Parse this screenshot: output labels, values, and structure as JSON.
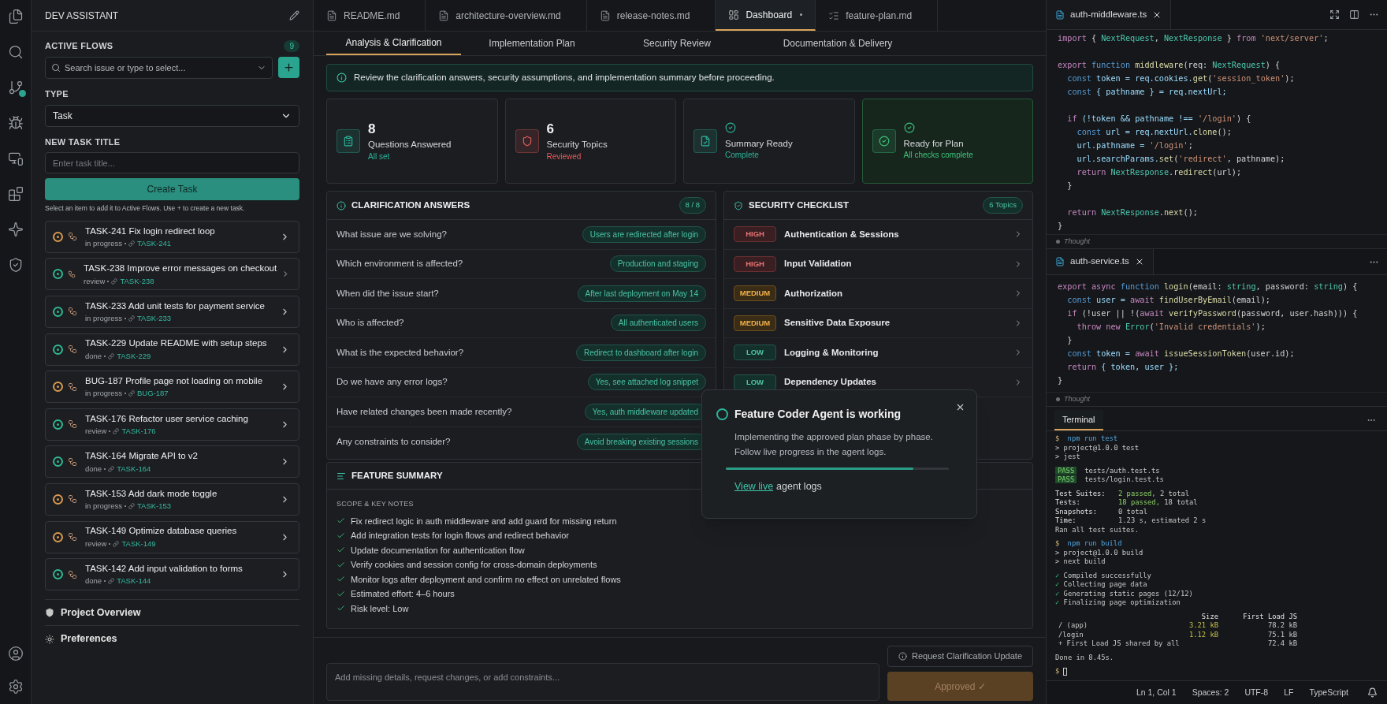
{
  "activity_bar": {
    "top": [
      {
        "kind": "files"
      },
      {
        "kind": "search"
      },
      {
        "kind": "git"
      },
      {
        "kind": "debug"
      },
      {
        "kind": "remote"
      },
      {
        "kind": "extensions"
      },
      {
        "kind": "sparkle"
      },
      {
        "kind": "shield"
      }
    ],
    "bottom": [
      {
        "kind": "account"
      },
      {
        "kind": "settings"
      }
    ]
  },
  "sidebar": {
    "title": "DEV ASSISTANT",
    "active_flows_label": "ACTIVE FLOWS",
    "active_flows_count": "9",
    "search": {
      "placeholder": "Search issue or type to select..."
    },
    "type_label": "TYPE",
    "type_value": "Task",
    "title_label": "NEW TASK TITLE",
    "title_field": {
      "placeholder": "Enter task title..."
    },
    "create_button": "Create Task",
    "help": "Select an item to add it to Active Flows. Use + to create a new task.",
    "tasks": [
      {
        "title": "TASK-241 Fix login redirect loop",
        "status": "in progress",
        "link": "TASK-241",
        "color": "#d99a4e"
      },
      {
        "title": "TASK-238 Improve error messages on checkout",
        "status": "review",
        "link": "TASK-238",
        "color": "#2fb88f"
      },
      {
        "title": "TASK-233 Add unit tests for payment service",
        "status": "in progress",
        "link": "TASK-233",
        "color": "#2fb88f"
      },
      {
        "title": "TASK-229 Update README with setup steps",
        "status": "done",
        "link": "TASK-229",
        "color": "#2fb88f"
      },
      {
        "title": "BUG-187 Profile page not loading on mobile",
        "status": "in progress",
        "link": "BUG-187",
        "color": "#d99a4e"
      },
      {
        "title": "TASK-176 Refactor user service caching",
        "status": "review",
        "link": "TASK-176",
        "color": "#2fb88f"
      },
      {
        "title": "TASK-164 Migrate API to v2",
        "status": "done",
        "link": "TASK-164",
        "color": "#2fb88f"
      },
      {
        "title": "TASK-153 Add dark mode toggle",
        "status": "in progress",
        "link": "TASK-153",
        "color": "#d99a4e"
      },
      {
        "title": "TASK-149 Optimize database queries",
        "status": "review",
        "link": "TASK-149",
        "color": "#d99a4e"
      },
      {
        "title": "TASK-142 Add input validation to forms",
        "status": "done",
        "link": "TASK-144",
        "color": "#2fb88f"
      }
    ],
    "footer_links": [
      {
        "label": "Project Overview",
        "kind": "shield"
      },
      {
        "label": "Preferences",
        "kind": "sun"
      }
    ]
  },
  "editor_tabs": [
    {
      "label": "README.md",
      "kind": "doc",
      "selected": false,
      "modified": false
    },
    {
      "label": "architecture-overview.md",
      "kind": "doc",
      "selected": false,
      "modified": false
    },
    {
      "label": "release-notes.md",
      "kind": "doc",
      "selected": false,
      "modified": false
    },
    {
      "label": "Dashboard",
      "kind": "dashboard",
      "selected": true,
      "modified": true
    },
    {
      "label": "feature-plan.md",
      "kind": "plan",
      "selected": false,
      "modified": false
    }
  ],
  "sub_tabs": [
    {
      "label": "Analysis & Clarification",
      "selected": true
    },
    {
      "label": "Implementation Plan",
      "selected": false
    },
    {
      "label": "Security Review",
      "selected": false
    },
    {
      "label": "Documentation & Delivery",
      "selected": false
    }
  ],
  "banner": "Review the clarification answers, security assumptions, and implementation summary before proceeding.",
  "stats": [
    {
      "kind": "count",
      "value": "8",
      "label": "Questions Answered",
      "sub": "All set",
      "color": "#2bb59a",
      "highlighted": false
    },
    {
      "kind": "count",
      "value": "6",
      "label": "Security Topics",
      "sub": "Reviewed",
      "color": "#e05a5a",
      "highlighted": false
    },
    {
      "kind": "check",
      "label": "Summary Ready",
      "sub": "Complete",
      "color": "#2bb59a",
      "highlighted": false
    },
    {
      "kind": "check",
      "label": "Ready for Plan",
      "sub": "All checks complete",
      "color": "#3cc47a",
      "highlighted": true
    }
  ],
  "clarification": {
    "title": "CLARIFICATION ANSWERS",
    "count": "8 / 8",
    "rows": [
      {
        "question": "What issue are we solving?",
        "answer": "Users are redirected after login"
      },
      {
        "question": "Which environment is affected?",
        "answer": "Production and staging"
      },
      {
        "question": "When did the issue start?",
        "answer": "After last deployment on May 14"
      },
      {
        "question": "Who is affected?",
        "answer": "All authenticated users"
      },
      {
        "question": "What is the expected behavior?",
        "answer": "Redirect to dashboard after login"
      },
      {
        "question": "Do we have any error logs?",
        "answer": "Yes, see attached log snippet"
      },
      {
        "question": "Have related changes been made recently?",
        "answer": "Yes, auth middleware updated"
      },
      {
        "question": "Any constraints to consider?",
        "answer": "Avoid breaking existing sessions"
      }
    ]
  },
  "security": {
    "title": "SECURITY CHECKLIST",
    "count": "6 Topics",
    "rows": [
      {
        "severity": "HIGH",
        "kind": "high",
        "topic": "Authentication & Sessions"
      },
      {
        "severity": "HIGH",
        "kind": "high",
        "topic": "Input Validation"
      },
      {
        "severity": "MEDIUM",
        "kind": "medium",
        "topic": "Authorization"
      },
      {
        "severity": "MEDIUM",
        "kind": "medium",
        "topic": "Sensitive Data Exposure"
      },
      {
        "severity": "LOW",
        "kind": "low",
        "topic": "Logging & Monitoring"
      },
      {
        "severity": "LOW",
        "kind": "low",
        "topic": "Dependency Updates"
      }
    ]
  },
  "summary": {
    "title": "FEATURE SUMMARY",
    "subtitle": "SCOPE & KEY NOTES",
    "items": [
      "Fix redirect logic in auth middleware and add guard for missing return",
      "Add integration tests for login flows and redirect behavior",
      "Update documentation for authentication flow",
      "Verify cookies and session config for cross-domain deployments",
      "Monitor logs after deployment and confirm no effect on unrelated flows",
      "Estimated effort: 4–6 hours",
      "Risk level: Low"
    ]
  },
  "composer": {
    "placeholder": "Add missing details, request changes, or add constraints...",
    "request_button": "Request Clarification Update",
    "approve_button": {
      "label": "Approved ✓",
      "disabled": true
    }
  },
  "agent_popup": {
    "title": "Feature Coder Agent is working",
    "lines": [
      "Implementing the approved plan phase by phase.",
      "Follow live progress in the agent logs."
    ],
    "level": 0.84,
    "link": "View live",
    "link_suffix": "agent logs"
  },
  "editors": [
    {
      "tab": "auth-middleware.ts",
      "footer": "Thought",
      "lines": [
        {
          "blank_before": false,
          "segs": [
            {
              "t": "import",
              "kind": "keyword"
            },
            {
              "t": " {",
              "kind": "plain"
            },
            {
              "t": " NextRequest",
              "kind": "type"
            },
            {
              "t": ",",
              "kind": "plain"
            },
            {
              "t": " NextResponse",
              "kind": "type"
            },
            {
              "t": " }",
              "kind": "plain"
            },
            {
              "t": " from",
              "kind": "keyword"
            },
            {
              "t": " 'next/server'",
              "kind": "string"
            },
            {
              "t": ";",
              "kind": "plain"
            }
          ]
        },
        {
          "blank_before": true,
          "segs": [
            {
              "t": "export",
              "kind": "keyword"
            },
            {
              "t": " function",
              "kind": "decl"
            },
            {
              "t": " middleware",
              "kind": "func"
            },
            {
              "t": "(req: ",
              "kind": "plain"
            },
            {
              "t": "NextRequest",
              "kind": "type"
            },
            {
              "t": ") {",
              "kind": "plain"
            }
          ]
        },
        {
          "blank_before": false,
          "segs": [
            {
              "t": "  const",
              "kind": "decl"
            },
            {
              "t": " token = req.cookies.",
              "kind": "var"
            },
            {
              "t": "get",
              "kind": "func"
            },
            {
              "t": "(",
              "kind": "plain"
            },
            {
              "t": "'session_token'",
              "kind": "string"
            },
            {
              "t": ");",
              "kind": "plain"
            }
          ]
        },
        {
          "blank_before": false,
          "segs": [
            {
              "t": "  const",
              "kind": "decl"
            },
            {
              "t": " { pathname } = req.nextUrl;",
              "kind": "var"
            }
          ]
        },
        {
          "blank_before": true,
          "segs": [
            {
              "t": "  if",
              "kind": "keyword"
            },
            {
              "t": " (!token && pathname !== ",
              "kind": "var"
            },
            {
              "t": "'/login'",
              "kind": "string"
            },
            {
              "t": ") {",
              "kind": "plain"
            }
          ]
        },
        {
          "blank_before": false,
          "segs": [
            {
              "t": "    const",
              "kind": "decl"
            },
            {
              "t": " url = req.nextUrl.",
              "kind": "var"
            },
            {
              "t": "clone",
              "kind": "func"
            },
            {
              "t": "();",
              "kind": "plain"
            }
          ]
        },
        {
          "blank_before": false,
          "segs": [
            {
              "t": "    url.pathname = ",
              "kind": "var"
            },
            {
              "t": "'/login'",
              "kind": "string"
            },
            {
              "t": ";",
              "kind": "plain"
            }
          ]
        },
        {
          "blank_before": false,
          "segs": [
            {
              "t": "    url.searchParams.",
              "kind": "var"
            },
            {
              "t": "set",
              "kind": "func"
            },
            {
              "t": "(",
              "kind": "plain"
            },
            {
              "t": "'redirect'",
              "kind": "string"
            },
            {
              "t": ", pathname);",
              "kind": "plain"
            }
          ]
        },
        {
          "blank_before": false,
          "segs": [
            {
              "t": "    return",
              "kind": "keyword"
            },
            {
              "t": " NextResponse",
              "kind": "type"
            },
            {
              "t": ".",
              "kind": "plain"
            },
            {
              "t": "redirect",
              "kind": "func"
            },
            {
              "t": "(url);",
              "kind": "plain"
            }
          ]
        },
        {
          "blank_before": false,
          "segs": [
            {
              "t": "  }",
              "kind": "plain"
            }
          ]
        },
        {
          "blank_before": true,
          "segs": [
            {
              "t": "  return",
              "kind": "keyword"
            },
            {
              "t": " NextResponse",
              "kind": "type"
            },
            {
              "t": ".",
              "kind": "plain"
            },
            {
              "t": "next",
              "kind": "func"
            },
            {
              "t": "();",
              "kind": "plain"
            }
          ]
        },
        {
          "blank_before": false,
          "segs": [
            {
              "t": "}",
              "kind": "plain"
            }
          ]
        }
      ]
    },
    {
      "tab": "auth-service.ts",
      "footer": "Thought",
      "lines": [
        {
          "blank_before": false,
          "segs": [
            {
              "t": "export",
              "kind": "keyword"
            },
            {
              "t": " async",
              "kind": "keyword"
            },
            {
              "t": " function",
              "kind": "decl"
            },
            {
              "t": " login",
              "kind": "func"
            },
            {
              "t": "(email: ",
              "kind": "plain"
            },
            {
              "t": "string",
              "kind": "type"
            },
            {
              "t": ", password: ",
              "kind": "plain"
            },
            {
              "t": "string",
              "kind": "type"
            },
            {
              "t": ") {",
              "kind": "plain"
            }
          ]
        },
        {
          "blank_before": false,
          "segs": [
            {
              "t": "  const",
              "kind": "decl"
            },
            {
              "t": " user = ",
              "kind": "var"
            },
            {
              "t": "await",
              "kind": "keyword"
            },
            {
              "t": " findUserByEmail",
              "kind": "func"
            },
            {
              "t": "(email);",
              "kind": "plain"
            }
          ]
        },
        {
          "blank_before": false,
          "segs": [
            {
              "t": "  if",
              "kind": "keyword"
            },
            {
              "t": " (!user || !(",
              "kind": "plain"
            },
            {
              "t": "await",
              "kind": "keyword"
            },
            {
              "t": " verifyPassword",
              "kind": "func"
            },
            {
              "t": "(password, user.hash))) {",
              "kind": "plain"
            }
          ]
        },
        {
          "blank_before": false,
          "segs": [
            {
              "t": "    throw",
              "kind": "keyword"
            },
            {
              "t": " new",
              "kind": "keyword"
            },
            {
              "t": " Error",
              "kind": "type"
            },
            {
              "t": "(",
              "kind": "plain"
            },
            {
              "t": "'Invalid credentials'",
              "kind": "string"
            },
            {
              "t": ");",
              "kind": "plain"
            }
          ]
        },
        {
          "blank_before": false,
          "segs": [
            {
              "t": "  }",
              "kind": "plain"
            }
          ]
        },
        {
          "blank_before": false,
          "segs": [
            {
              "t": "  const",
              "kind": "decl"
            },
            {
              "t": " token = ",
              "kind": "var"
            },
            {
              "t": "await",
              "kind": "keyword"
            },
            {
              "t": " issueSessionToken",
              "kind": "func"
            },
            {
              "t": "(user.id);",
              "kind": "plain"
            }
          ]
        },
        {
          "blank_before": false,
          "segs": [
            {
              "t": "  return",
              "kind": "keyword"
            },
            {
              "t": " { token, user };",
              "kind": "var"
            }
          ]
        },
        {
          "blank_before": false,
          "segs": [
            {
              "t": "}",
              "kind": "plain"
            }
          ]
        }
      ]
    }
  ],
  "terminal": {
    "tab": "Terminal",
    "lines": [
      {
        "kind": "text",
        "blank_before": false,
        "segs": [
          {
            "t": "$",
            "kind": "prompt"
          },
          {
            "t": " npm run test",
            "kind": "cmd"
          }
        ]
      },
      {
        "kind": "text",
        "blank_before": false,
        "segs": [
          {
            "t": "> project@1.0.0 test",
            "kind": "out"
          }
        ]
      },
      {
        "kind": "text",
        "blank_before": false,
        "segs": [
          {
            "t": "> jest",
            "kind": "out"
          }
        ]
      },
      {
        "kind": "text",
        "blank_before": true,
        "segs": [
          {
            "t": "PASS",
            "kind": "pass"
          },
          {
            "t": "tests/auth.test.ts",
            "kind": "out"
          }
        ]
      },
      {
        "kind": "text",
        "blank_before": false,
        "segs": [
          {
            "t": "PASS",
            "kind": "pass"
          },
          {
            "t": "tests/login.test.ts",
            "kind": "out"
          }
        ]
      },
      {
        "kind": "text",
        "blank_before": true,
        "segs": [
          {
            "t": "Test Suites:",
            "kind": "label"
          },
          {
            "t": "2 passed,",
            "kind": "ok"
          },
          {
            "t": " 2 total",
            "kind": "out"
          }
        ]
      },
      {
        "kind": "text",
        "blank_before": false,
        "segs": [
          {
            "t": "Tests:",
            "kind": "label"
          },
          {
            "t": "18 passed,",
            "kind": "ok"
          },
          {
            "t": " 18 total",
            "kind": "out"
          }
        ]
      },
      {
        "kind": "text",
        "blank_before": false,
        "segs": [
          {
            "t": "Snapshots:",
            "kind": "label"
          },
          {
            "t": "0 total",
            "kind": "out"
          }
        ]
      },
      {
        "kind": "text",
        "blank_before": false,
        "segs": [
          {
            "t": "Time:",
            "kind": "label"
          },
          {
            "t": "1.23 s, estimated 2 s",
            "kind": "out"
          }
        ]
      },
      {
        "kind": "text",
        "blank_before": false,
        "segs": [
          {
            "t": "Ran all test suites.",
            "kind": "out"
          }
        ]
      },
      {
        "kind": "text",
        "blank_before": true,
        "segs": [
          {
            "t": "$",
            "kind": "prompt"
          },
          {
            "t": " npm run build",
            "kind": "cmd"
          }
        ]
      },
      {
        "kind": "text",
        "blank_before": false,
        "segs": [
          {
            "t": "> project@1.0.0 build",
            "kind": "out"
          }
        ]
      },
      {
        "kind": "text",
        "blank_before": false,
        "segs": [
          {
            "t": "> next build",
            "kind": "out"
          }
        ]
      },
      {
        "kind": "text",
        "blank_before": true,
        "segs": [
          {
            "t": "✓",
            "kind": "check"
          },
          {
            "t": " Compiled successfully",
            "kind": "out"
          }
        ]
      },
      {
        "kind": "text",
        "blank_before": false,
        "segs": [
          {
            "t": "✓",
            "kind": "check"
          },
          {
            "t": " Collecting page data",
            "kind": "out"
          }
        ]
      },
      {
        "kind": "text",
        "blank_before": false,
        "segs": [
          {
            "t": "✓",
            "kind": "check"
          },
          {
            "t": " Generating static pages (12/12)",
            "kind": "out"
          }
        ]
      },
      {
        "kind": "text",
        "blank_before": false,
        "segs": [
          {
            "t": "✓",
            "kind": "check"
          },
          {
            "t": " Finalizing page optimization",
            "kind": "out"
          }
        ]
      },
      {
        "kind": "table",
        "blank_before": true,
        "head": [
          "Size",
          "First Load JS"
        ],
        "rows": [
          {
            "route": "/ (app)",
            "size": "3.21 kB",
            "first": "78.2 kB"
          },
          {
            "route": "/login",
            "size": "1.12 kB",
            "first": "75.1 kB"
          },
          {
            "route": "+ First Load JS shared by all",
            "first": "72.4 kB"
          }
        ]
      },
      {
        "kind": "text",
        "blank_before": true,
        "segs": [
          {
            "t": "Done in 8.45s.",
            "kind": "out"
          }
        ]
      },
      {
        "kind": "cursor",
        "blank_before": true,
        "segs": [
          {
            "t": "$",
            "kind": "prompt"
          }
        ]
      }
    ]
  },
  "status_bar": [
    "Ln 1, Col 1",
    "Spaces: 2",
    "UTF-8",
    "LF",
    "TypeScript"
  ]
}
